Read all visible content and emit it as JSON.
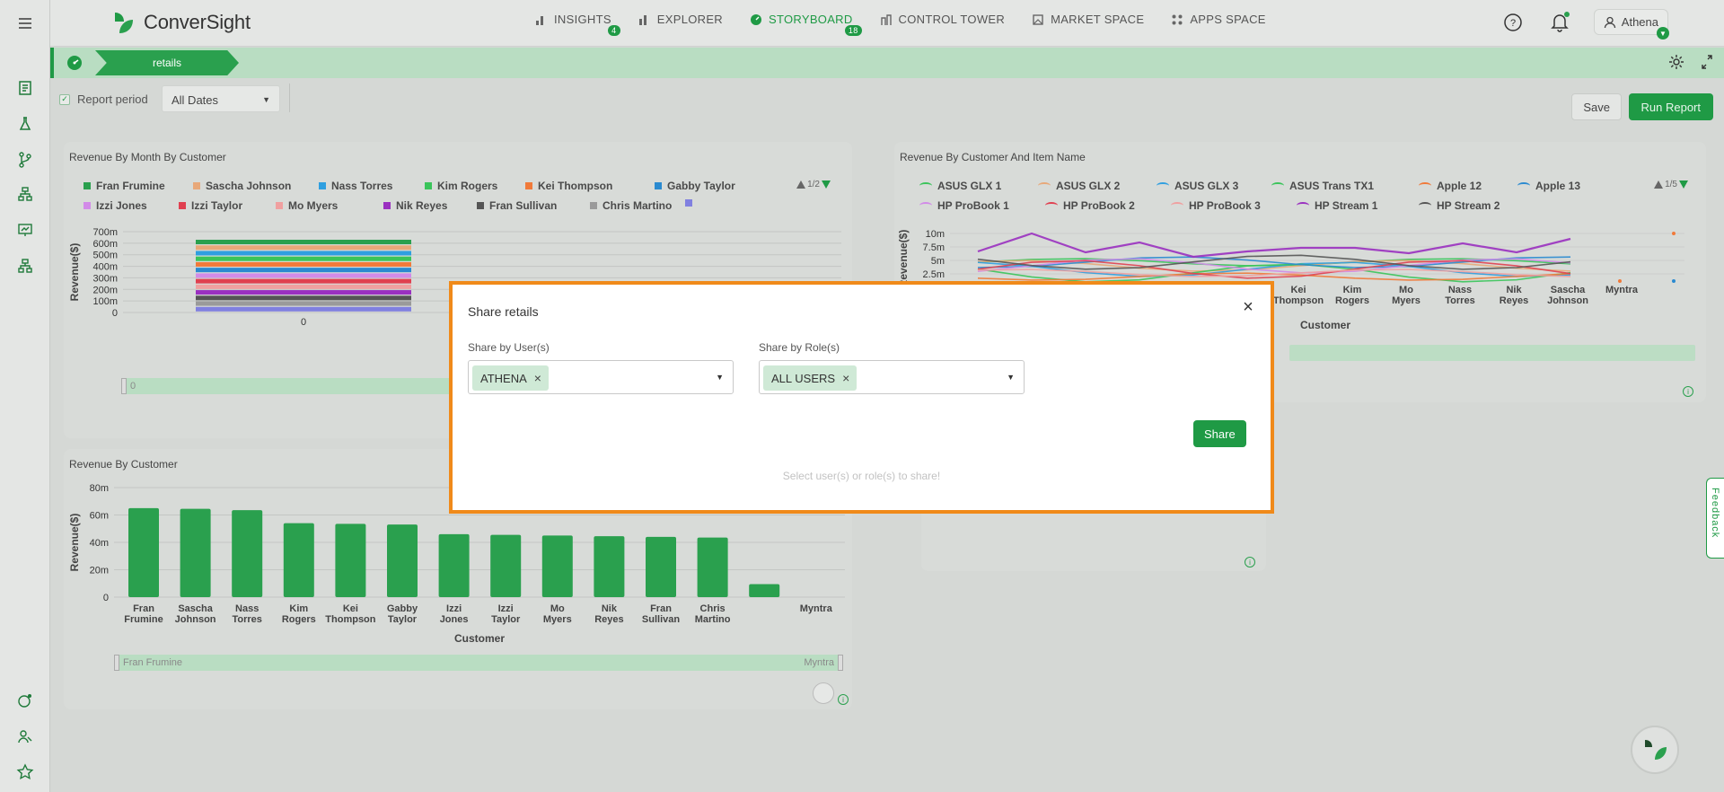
{
  "app": {
    "name": "ConverSight"
  },
  "nav": [
    {
      "label": "INSIGHTS",
      "badge": "4",
      "active": false
    },
    {
      "label": "EXPLORER",
      "badge": "",
      "active": false
    },
    {
      "label": "STORYBOARD",
      "badge": "18",
      "active": true
    },
    {
      "label": "CONTROL TOWER",
      "badge": "",
      "active": false
    },
    {
      "label": "MARKET SPACE",
      "badge": "",
      "active": false
    },
    {
      "label": "APPS SPACE",
      "badge": "",
      "active": false
    }
  ],
  "user": {
    "name": "Athena"
  },
  "story": {
    "tab": "retails"
  },
  "filters": {
    "report_period_label": "Report period",
    "date_value": "All Dates"
  },
  "actions": {
    "save": "Save",
    "run_report": "Run Report"
  },
  "charts": {
    "month": {
      "title": "Revenue By Month By Customer",
      "pager": "1/2",
      "legend": [
        {
          "name": "Fran Frumine",
          "color": "#2aa04e"
        },
        {
          "name": "Sascha Johnson",
          "color": "#e8a879"
        },
        {
          "name": "Nass Torres",
          "color": "#2f9fe0"
        },
        {
          "name": "Kim Rogers",
          "color": "#3ac45a"
        },
        {
          "name": "Kei Thompson",
          "color": "#f07a3a"
        },
        {
          "name": "Gabby Taylor",
          "color": "#2a8ad0"
        },
        {
          "name": "Izzi Jones",
          "color": "#d28be8"
        },
        {
          "name": "Izzi Taylor",
          "color": "#e04050"
        },
        {
          "name": "Mo Myers",
          "color": "#f0a0a0"
        },
        {
          "name": "Nik Reyes",
          "color": "#9a30c0"
        },
        {
          "name": "Fran Sullivan",
          "color": "#555555"
        },
        {
          "name": "Chris Martino",
          "color": "#9a9a9a"
        },
        {
          "name": "",
          "color": "#8080e0"
        }
      ],
      "ylabel": "Revenue($)",
      "yticks": [
        "700m",
        "600m",
        "500m",
        "400m",
        "300m",
        "200m",
        "100m",
        "0"
      ],
      "xtick": "0",
      "slider_label": "0"
    },
    "customer_item": {
      "title": "Revenue By Customer And Item Name",
      "pager": "1/5",
      "legend": [
        {
          "name": "ASUS GLX 1",
          "color": "#3ac45a"
        },
        {
          "name": "ASUS GLX 2",
          "color": "#e8a879"
        },
        {
          "name": "ASUS GLX 3",
          "color": "#2f9fe0"
        },
        {
          "name": "ASUS Trans TX1",
          "color": "#3ac45a"
        },
        {
          "name": "Apple 12",
          "color": "#f07a3a"
        },
        {
          "name": "Apple 13",
          "color": "#2a8ad0"
        },
        {
          "name": "HP ProBook 1",
          "color": "#d28be8"
        },
        {
          "name": "HP ProBook 2",
          "color": "#e04050"
        },
        {
          "name": "HP ProBook 3",
          "color": "#f0a0a0"
        },
        {
          "name": "HP Stream 1",
          "color": "#9a30c0"
        },
        {
          "name": "HP Stream 2",
          "color": "#555555"
        }
      ],
      "ylabel": "Revenue($)",
      "yticks": [
        "10m",
        "7.5m",
        "5m",
        "2.5m"
      ],
      "xcats": [
        "Kei Thompson",
        "Kim Rogers",
        "Mo Myers",
        "Nass Torres",
        "Nik Reyes",
        "Sascha Johnson",
        "Myntra"
      ],
      "xlabel": "Customer"
    },
    "customer": {
      "title": "Revenue By Customer",
      "ylabel": "Revenue($)",
      "xlabel": "Customer",
      "slider_start": "Fran Frumine",
      "slider_end": "Myntra"
    }
  },
  "chart_data": [
    {
      "type": "bar",
      "title": "Revenue By Customer",
      "xlabel": "Customer",
      "ylabel": "Revenue($)",
      "ylim": [
        0,
        80
      ],
      "yticks": [
        "0",
        "20m",
        "40m",
        "60m",
        "80m"
      ],
      "categories": [
        "Fran Frumine",
        "Sascha Johnson",
        "Nass Torres",
        "Kim Rogers",
        "Kei Thompson",
        "Gabby Taylor",
        "Izzi Jones",
        "Izzi Taylor",
        "Mo Myers",
        "Nik Reyes",
        "Fran Sullivan",
        "Chris Martino",
        "",
        "Myntra"
      ],
      "values": [
        65,
        64.5,
        63.5,
        54,
        53.5,
        53,
        46,
        45.5,
        45,
        44.5,
        44,
        43.5,
        9.5,
        0
      ],
      "color": "#2aa04e"
    }
  ],
  "modal": {
    "title": "Share retails",
    "users_label": "Share by User(s)",
    "users_chip": "ATHENA",
    "roles_label": "Share by Role(s)",
    "roles_chip": "ALL USERS",
    "share_button": "Share",
    "hint": "Select user(s) or role(s) to share!"
  },
  "feedback": "Feedback",
  "colors": {
    "brand": "#1f9a45",
    "modal_border": "#f08a1a"
  }
}
